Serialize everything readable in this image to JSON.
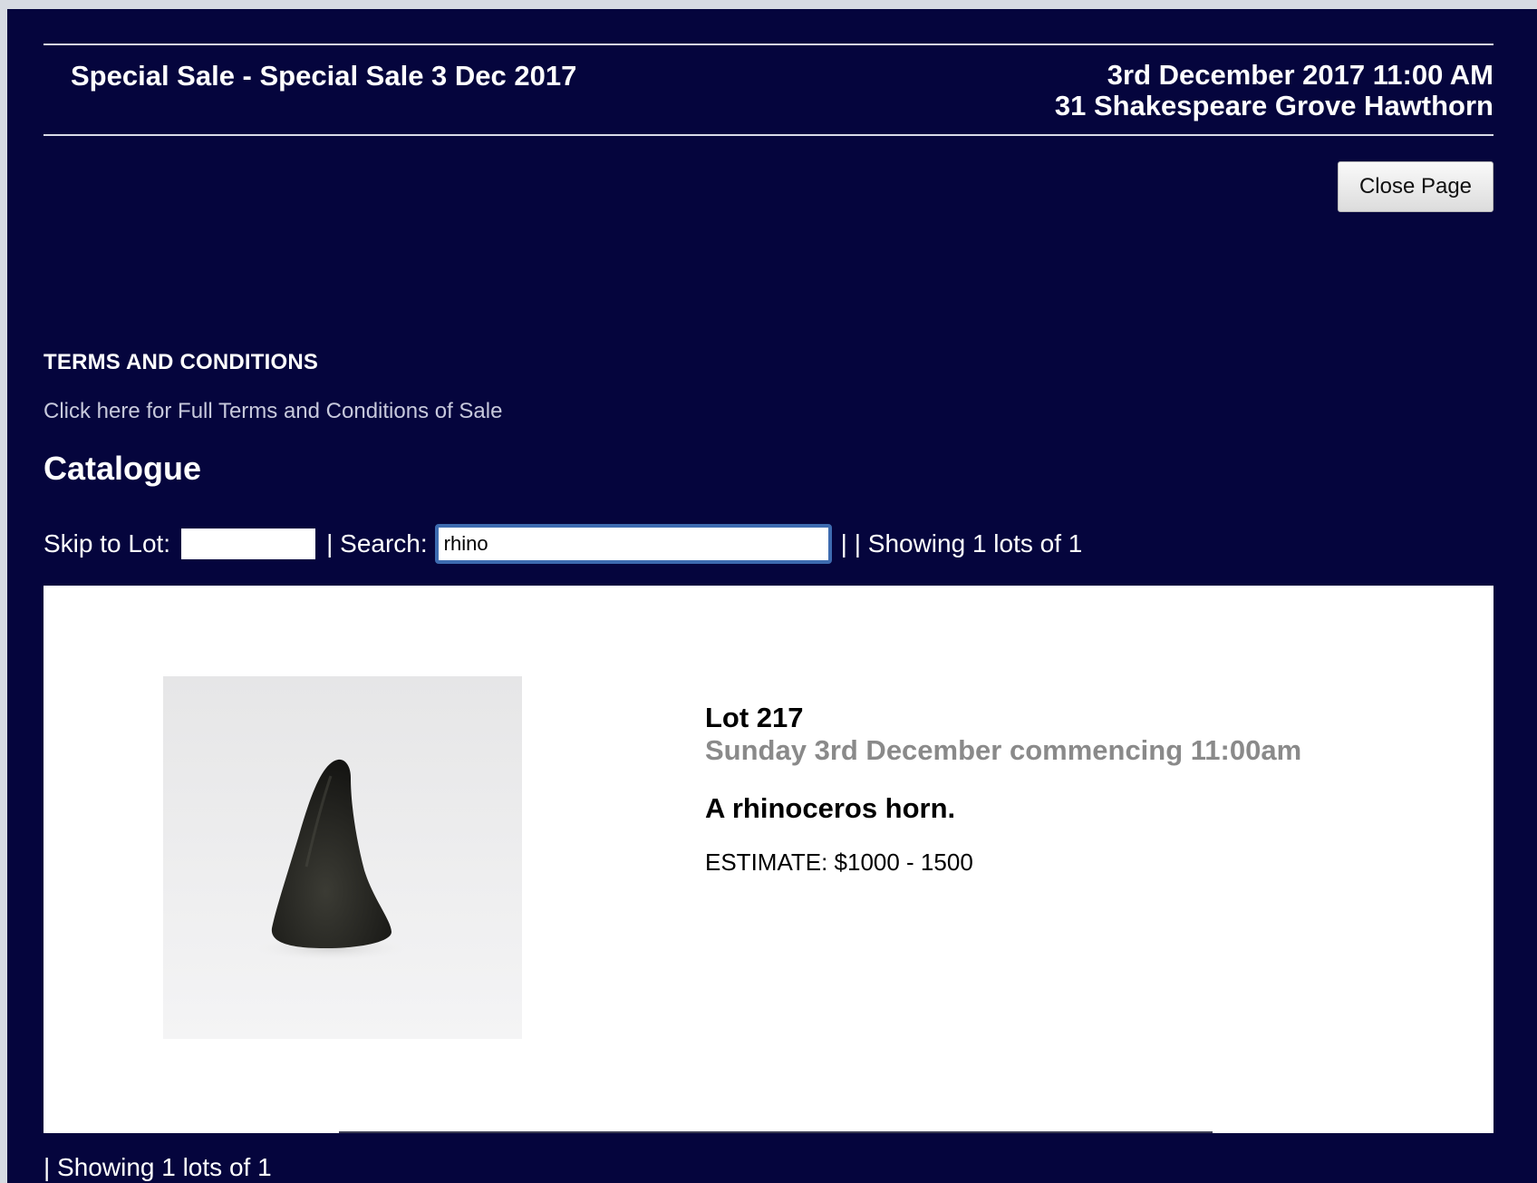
{
  "header": {
    "sale_title": "Special Sale - Special Sale 3 Dec 2017",
    "sale_datetime": "3rd December 2017 11:00 AM",
    "sale_address": "31 Shakespeare Grove Hawthorn"
  },
  "actions": {
    "close_label": "Close Page"
  },
  "terms": {
    "heading": "TERMS AND CONDITIONS",
    "link_text": "Click here for Full Terms and Conditions of Sale"
  },
  "catalogue": {
    "title": "Catalogue",
    "skip_label": "Skip to Lot:",
    "skip_value": "",
    "search_label": "| Search:",
    "search_value": "rhino",
    "result_count": "| | Showing 1 lots of 1",
    "bottom_count": "| Showing 1 lots of 1"
  },
  "lot": {
    "number": "Lot 217",
    "session": "Sunday 3rd December commencing 11:00am",
    "description": "A rhinoceros horn.",
    "estimate": "ESTIMATE: $1000 - 1500",
    "image_icon": "rhino-horn-photo"
  },
  "colors": {
    "page_background": "#05053d",
    "panel_background": "#ffffff",
    "session_text": "#8a8a8a",
    "link_text": "#c7c9dc"
  }
}
